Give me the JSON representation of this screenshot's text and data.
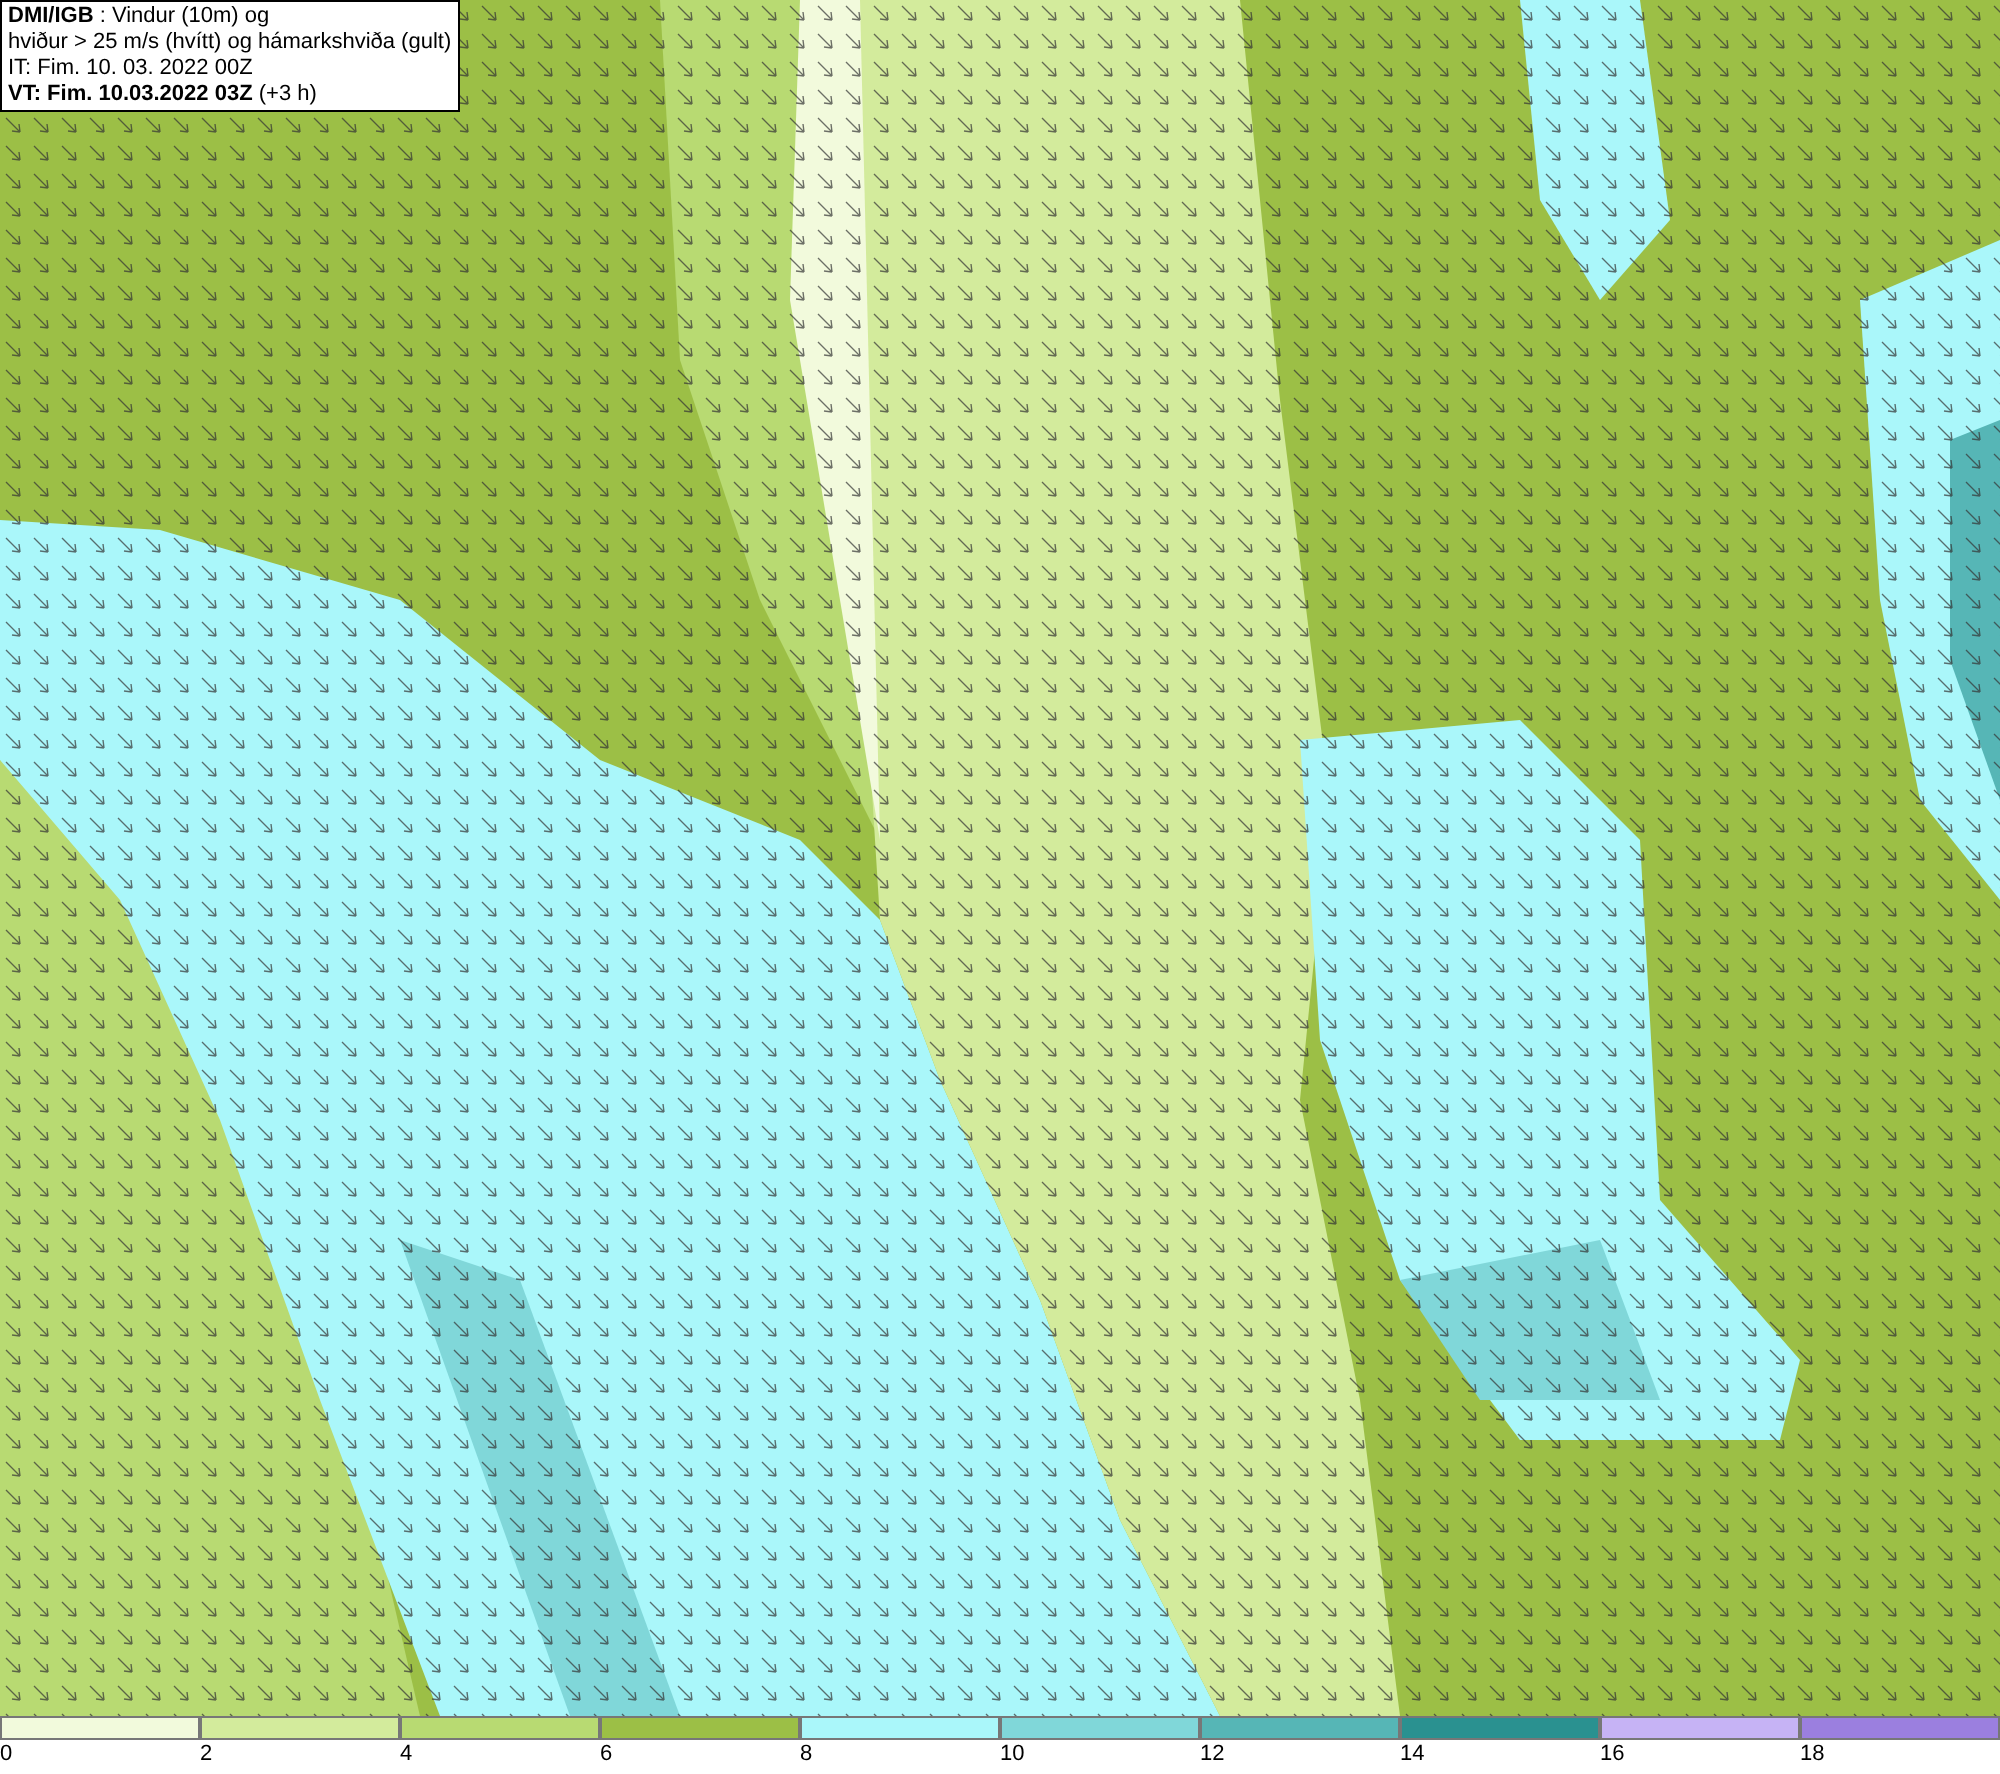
{
  "title_box": {
    "lines": [
      "**DMI/IGB** : Vindur (10m) og",
      "hviður > 25 m/s (hvítt) og hámarkshviða (gult)",
      "IT: Fim. 10. 03. 2022 00Z",
      "**VT: Fim. 10.03.2022 03Z** (+3 h)"
    ]
  },
  "legend": {
    "bins": [
      {
        "color": "#f2fadc",
        "label": "0"
      },
      {
        "color": "#d3eb9c",
        "label": "2"
      },
      {
        "color": "#b8da72",
        "label": "4"
      },
      {
        "color": "#9cbf46",
        "label": "6"
      },
      {
        "color": "#aaf7fa",
        "label": "8"
      },
      {
        "color": "#80d7d9",
        "label": "10"
      },
      {
        "color": "#56b6b6",
        "label": "12"
      },
      {
        "color": "#2a9190",
        "label": "14"
      },
      {
        "color": "#c6b3f5",
        "label": "16"
      },
      {
        "color": "#9b7fdf",
        "label": "18"
      }
    ]
  }
}
